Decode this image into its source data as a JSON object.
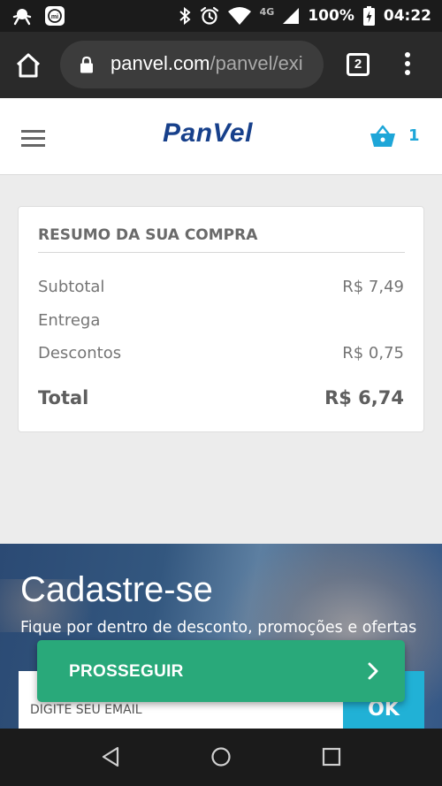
{
  "status_bar": {
    "network": "4G",
    "battery": "100%",
    "time": "04:22"
  },
  "browser": {
    "url_domain": "panvel.com",
    "url_path": "/panvel/exi",
    "tab_count": "2"
  },
  "header": {
    "logo": "PanVel",
    "cart_count": "1"
  },
  "summary": {
    "title": "RESUMO DA SUA COMPRA",
    "rows": [
      {
        "label": "Subtotal",
        "value": "R$ 7,49"
      },
      {
        "label": "Entrega",
        "value": ""
      },
      {
        "label": "Descontos",
        "value": "R$ 0,75"
      }
    ],
    "total_label": "Total",
    "total_value": "R$ 6,74"
  },
  "newsletter": {
    "title": "Cadastre-se",
    "subtitle": "Fique por dentro de desconto, promoções e ofertas",
    "email_placeholder": "DIGITE SEU EMAIL",
    "ok_label": "OK"
  },
  "proceed": {
    "label": "PROSSEGUIR"
  },
  "colors": {
    "brand_blue": "#17408b",
    "accent_cyan": "#1ea6d8",
    "proceed_green": "#29a97a"
  }
}
